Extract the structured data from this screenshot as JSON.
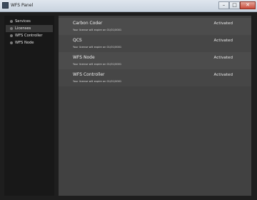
{
  "window": {
    "title": "WFS Panel",
    "faded_title_fragments": [
      "",
      "",
      ""
    ],
    "controls": [
      "–",
      "□",
      "✕"
    ]
  },
  "sidebar": {
    "items": [
      {
        "label": "Services",
        "active": false
      },
      {
        "label": "Licenses",
        "active": true
      },
      {
        "label": "WFS Controller",
        "active": false
      },
      {
        "label": "WFS Node",
        "active": false
      }
    ]
  },
  "licenses": [
    {
      "name": "Carbon Coder",
      "status": "Activated",
      "expiry": "Your license will expire on 01/01/0001"
    },
    {
      "name": "QCS",
      "status": "Activated",
      "expiry": "Your license will expire on 01/01/0001"
    },
    {
      "name": "WFS Node",
      "status": "Activated",
      "expiry": "Your license will expire on 01/01/0001"
    },
    {
      "name": "WFS Controller",
      "status": "Activated",
      "expiry": "Your license will expire on 01/01/0001"
    }
  ],
  "colors": {
    "background": "#1e1e1e",
    "sidebar": "#181818",
    "content": "#414141",
    "active_item": "#383838"
  }
}
